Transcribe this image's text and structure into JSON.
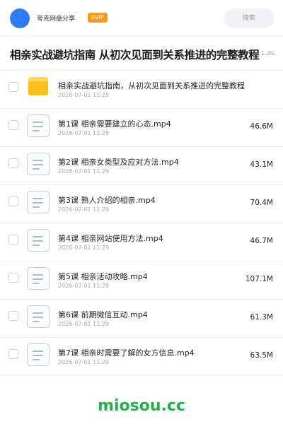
{
  "header": {
    "app_name": "夸克网盘分享",
    "badge": "SVIP",
    "search_placeholder": "搜索"
  },
  "share": {
    "title": "相亲实战避坑指南 从初次见面到关系推进的完整教程",
    "total_size": "1.2G"
  },
  "items": [
    {
      "type": "folder",
      "name": "相亲实战避坑指南，从初次见面到关系推进的完整教程",
      "date": "2026-07-01 11:29",
      "size": ""
    },
    {
      "type": "file",
      "name": "第1课 相亲需要建立的心态.mp4",
      "date": "2026-07-01 11:29",
      "size": "46.6M"
    },
    {
      "type": "file",
      "name": "第2课 相亲女类型及应对方法.mp4",
      "date": "2026-07-01 11:29",
      "size": "43.1M"
    },
    {
      "type": "file",
      "name": "第3课 熟人介绍的相亲.mp4",
      "date": "2026-07-01 11:29",
      "size": "70.4M"
    },
    {
      "type": "file",
      "name": "第4课 相亲网站使用方法.mp4",
      "date": "2026-07-01 11:29",
      "size": "46.7M"
    },
    {
      "type": "file",
      "name": "第5课 相亲活动攻略.mp4",
      "date": "2026-07-01 11:29",
      "size": "107.1M"
    },
    {
      "type": "file",
      "name": "第6课 前期微信互动.mp4",
      "date": "2026-07-01 11:29",
      "size": "61.3M"
    },
    {
      "type": "file",
      "name": "第7课 相亲时需要了解的女方信息.mp4",
      "date": "2026-07-01 11:29",
      "size": "63.5M"
    }
  ],
  "watermark": "miosou.cc",
  "colors": {
    "avatar": "#2f7bf5",
    "svip_badge": "#f79b1e",
    "folder": "#fcbf1c",
    "watermark": "#21b14b"
  }
}
